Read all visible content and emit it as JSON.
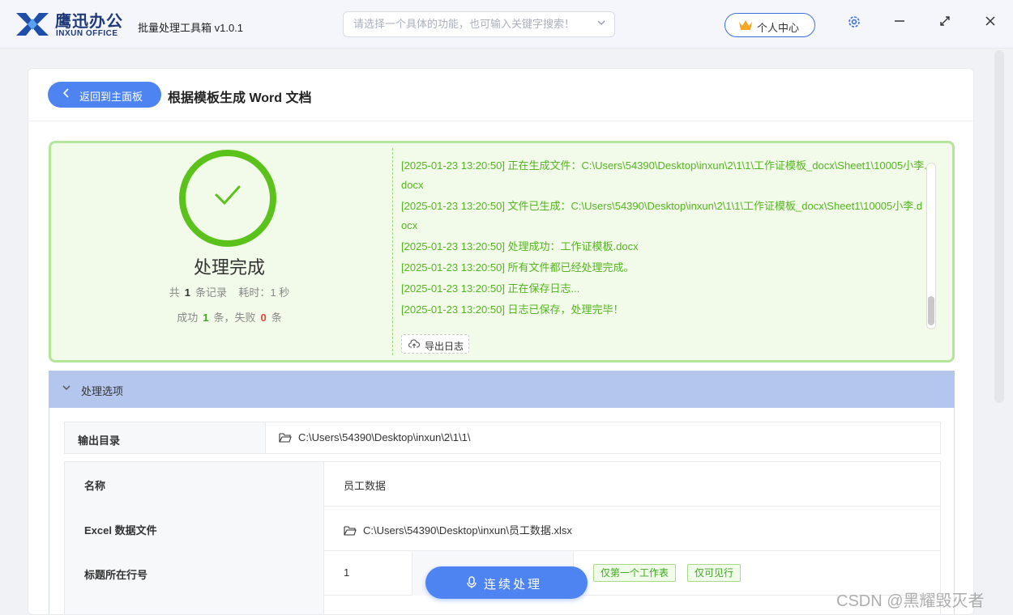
{
  "app": {
    "brand_cn": "鹰迅办公",
    "brand_en": "INXUN OFFICE",
    "name": "批量处理工具箱 v1.0.1"
  },
  "search": {
    "placeholder": "请选择一个具体的功能，也可输入关键字搜索！"
  },
  "profile": {
    "label": "个人中心",
    "icon": "crown-icon"
  },
  "header": {
    "back_label": "返回到主面板",
    "title": "根据模板生成 Word 文档"
  },
  "result": {
    "title": "处理完成",
    "total_prefix": "共",
    "total": "1",
    "total_suffix": "条记录",
    "time_prefix": "耗时：",
    "time_value": "1 秒",
    "success_prefix": "成功",
    "success": "1",
    "success_mid": "条，失败",
    "fail": "0",
    "fail_suffix": "条",
    "logs": [
      "[2025-01-23 13:20:50] 正在生成文件：C:\\Users\\54390\\Desktop\\inxun\\2\\1\\1\\工作证模板_docx\\Sheet1\\10005小李.docx",
      "[2025-01-23 13:20:50] 文件已生成：C:\\Users\\54390\\Desktop\\inxun\\2\\1\\1\\工作证模板_docx\\Sheet1\\10005小李.docx",
      "[2025-01-23 13:20:50] 处理成功：工作证模板.docx",
      "[2025-01-23 13:20:50] 所有文件都已经处理完成。",
      "[2025-01-23 13:20:50] 正在保存日志...",
      "[2025-01-23 13:20:50] 日志已保存，处理完毕！"
    ],
    "export_label": "导出日志"
  },
  "options": {
    "heading": "处理选项",
    "output_dir_label": "输出目录",
    "output_dir_value": "C:\\Users\\54390\\Desktop\\inxun\\2\\1\\1\\",
    "rows": [
      {
        "label": "名称",
        "value": "员工数据"
      },
      {
        "label": "Excel 数据文件",
        "value": "C:\\Users\\54390\\Desktop\\inxun\\员工数据.xlsx"
      },
      {
        "label": "标题所在行号",
        "value": "1"
      }
    ],
    "tags": [
      "仅第一个工作表",
      "仅可见行"
    ]
  },
  "run_label": "连续处理",
  "watermark": "CSDN @黑耀毁灭者",
  "colors": {
    "accent": "#4d84f1",
    "success": "#5bc21c",
    "fail": "#e8413b",
    "log_text": "#54b51f"
  }
}
